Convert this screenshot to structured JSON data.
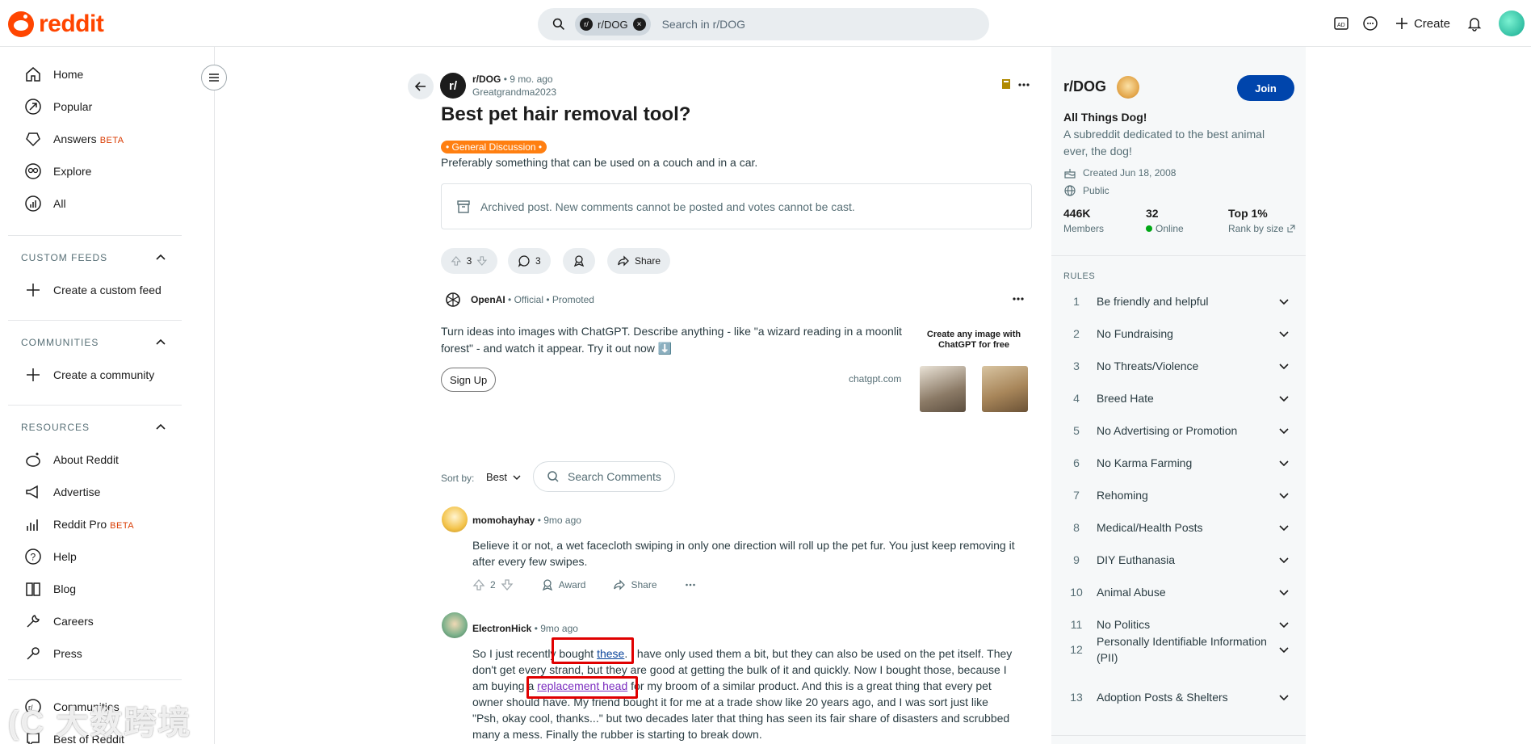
{
  "header": {
    "logo_text": "reddit",
    "search_chip": "r/DOG",
    "search_placeholder": "Search in r/DOG",
    "create_label": "Create"
  },
  "sidebar": {
    "items": [
      {
        "label": "Home"
      },
      {
        "label": "Popular"
      },
      {
        "label": "Answers",
        "badge": "BETA"
      },
      {
        "label": "Explore"
      },
      {
        "label": "All"
      }
    ],
    "custom_feeds": {
      "heading": "CUSTOM FEEDS",
      "action": "Create a custom feed"
    },
    "communities": {
      "heading": "COMMUNITIES",
      "action": "Create a community"
    },
    "resources": {
      "heading": "RESOURCES",
      "items": [
        {
          "label": "About Reddit"
        },
        {
          "label": "Advertise"
        },
        {
          "label": "Reddit Pro",
          "badge": "BETA"
        },
        {
          "label": "Help"
        },
        {
          "label": "Blog"
        },
        {
          "label": "Careers"
        },
        {
          "label": "Press"
        }
      ]
    },
    "bottom": [
      {
        "label": "Communities"
      },
      {
        "label": "Best of Reddit"
      }
    ]
  },
  "post": {
    "subreddit": "r/DOG",
    "age": "9 mo. ago",
    "author": "Greatgrandma2023",
    "title": "Best pet hair removal tool?",
    "flair": "• General Discussion •",
    "body": "Preferably something that can be used on a couch and in a car.",
    "archived_notice": "Archived post. New comments cannot be posted and votes cannot be cast.",
    "votes": "3",
    "comments": "3",
    "share_label": "Share"
  },
  "ad": {
    "advertiser": "OpenAI",
    "official": "Official",
    "promoted": "Promoted",
    "text": "Turn ideas into images with ChatGPT. Describe anything - like \"a wizard reading in a moonlit forest\" - and watch it appear. Try it out now ⬇️",
    "cta": "Sign Up",
    "domain": "chatgpt.com",
    "image_caption": "Create any image with ChatGPT for free"
  },
  "sort": {
    "label": "Sort by:",
    "value": "Best",
    "search_placeholder": "Search Comments"
  },
  "comments": [
    {
      "author": "momohayhay",
      "age": "9mo ago",
      "body": "Believe it or not, a wet facecloth swiping in only one direction will roll up the pet fur. You just keep removing it after every few swipes.",
      "votes": "2",
      "award_label": "Award",
      "share_label": "Share"
    },
    {
      "author": "ElectronHick",
      "age": "9mo ago",
      "body_1": "So I just recently bought ",
      "link_1": "these",
      "body_2": ". I have only used them a bit, but they can also be used on the pet itself. They don't get every strand, but they are good at getting the bulk of it and quickly. Now I bought those, because I am buying ",
      "body_2b": "a ",
      "link_2": "replacement head",
      "body_3": " for my broom of a similar product. And this is a great thing that every pet owner should have. My friend bought it for me at a trade show like 20 years ago, and I was sort just like \"Psh, okay cool, thanks...\" but two decades later that thing has seen its fair share of disasters and scrubbed many a mess. Finally the rubber is starting to break down."
    }
  ],
  "community": {
    "name": "r/DOG",
    "join_label": "Join",
    "tagline": "All Things Dog!",
    "description": "A subreddit dedicated to the best animal ever, the dog!",
    "created": "Created Jun 18, 2008",
    "visibility": "Public",
    "stats": [
      {
        "value": "446K",
        "label": "Members"
      },
      {
        "value": "32",
        "label": "Online"
      },
      {
        "value": "Top 1%",
        "label": "Rank by size"
      }
    ],
    "rules_heading": "RULES",
    "rules": [
      {
        "num": "1",
        "text": "Be friendly and helpful"
      },
      {
        "num": "2",
        "text": "No Fundraising"
      },
      {
        "num": "3",
        "text": "No Threats/Violence"
      },
      {
        "num": "4",
        "text": "Breed Hate"
      },
      {
        "num": "5",
        "text": "No Advertising or Promotion"
      },
      {
        "num": "6",
        "text": "No Karma Farming"
      },
      {
        "num": "7",
        "text": "Rehoming"
      },
      {
        "num": "8",
        "text": "Medical/Health Posts"
      },
      {
        "num": "9",
        "text": "DIY Euthanasia"
      },
      {
        "num": "10",
        "text": "Animal Abuse"
      },
      {
        "num": "11",
        "text": "No Politics"
      },
      {
        "num": "12",
        "text": "Personally Identifiable Information (PII)"
      },
      {
        "num": "13",
        "text": "Adoption Posts & Shelters"
      }
    ]
  },
  "colors": {
    "brand": "#ff4500",
    "join": "#0045ac",
    "flair": "#ff7f11",
    "highlight": "#e00000"
  },
  "watermark": "大数跨境"
}
